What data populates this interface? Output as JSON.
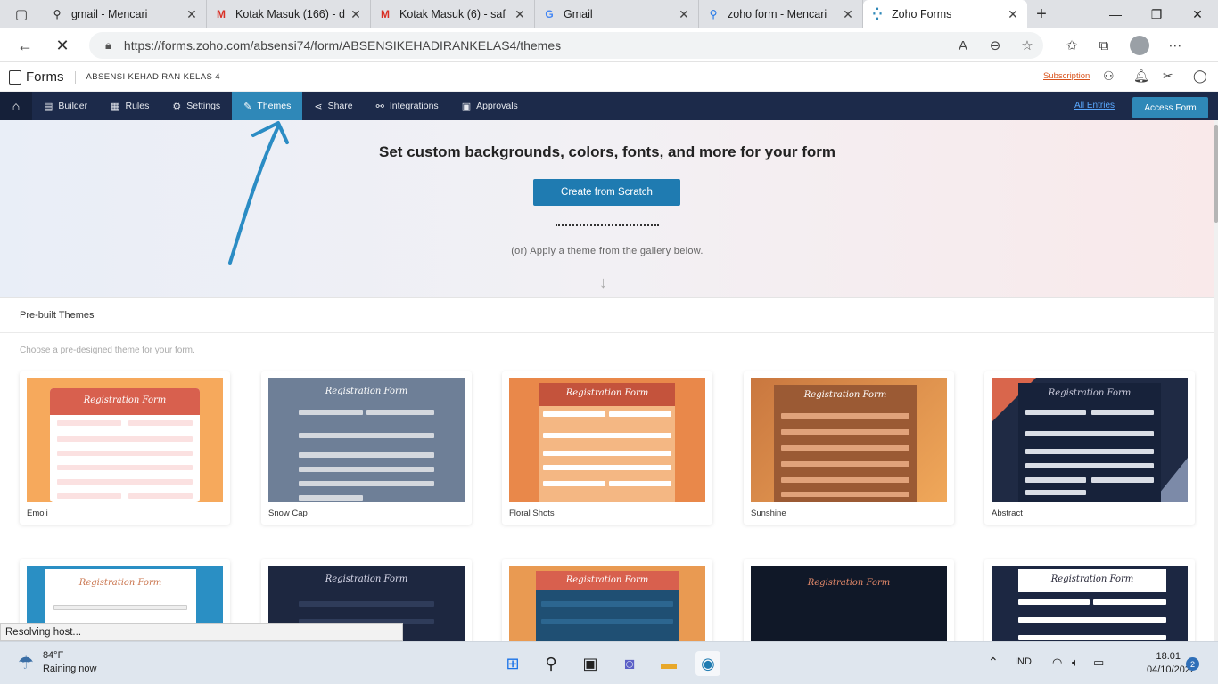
{
  "browser": {
    "tabs": [
      {
        "title": "gmail - Mencari",
        "favicon": "search-icon"
      },
      {
        "title": "Kotak Masuk (166) - d",
        "favicon": "gmail-icon"
      },
      {
        "title": "Kotak Masuk (6) - saf",
        "favicon": "gmail-icon"
      },
      {
        "title": "Gmail",
        "favicon": "google-icon"
      },
      {
        "title": "zoho form - Mencari",
        "favicon": "search-icon"
      },
      {
        "title": "Zoho Forms",
        "favicon": "zoho-icon"
      }
    ],
    "url": "https://forms.zoho.com/absensi74/form/ABSENSIKEHADIRANKELAS4/themes"
  },
  "zoho": {
    "logo": "Forms",
    "form_name": "ABSENSI KEHADIRAN KELAS 4",
    "subscription": "Subscription",
    "nav": [
      {
        "label": "Builder"
      },
      {
        "label": "Rules"
      },
      {
        "label": "Settings"
      },
      {
        "label": "Themes"
      },
      {
        "label": "Share"
      },
      {
        "label": "Integrations"
      },
      {
        "label": "Approvals"
      }
    ],
    "all_entries": "All Entries",
    "access_form": "Access Form"
  },
  "hero": {
    "heading": "Set custom backgrounds, colors, fonts, and more for your form",
    "button": "Create from Scratch",
    "or_text": "(or) Apply a theme from the gallery below."
  },
  "themes": {
    "title": "Pre-built Themes",
    "subtitle": "Choose a pre-designed theme for your form.",
    "preview_title": "Registration Form",
    "items": [
      {
        "name": "Emoji"
      },
      {
        "name": "Snow Cap"
      },
      {
        "name": "Floral Shots"
      },
      {
        "name": "Sunshine"
      },
      {
        "name": "Abstract"
      }
    ]
  },
  "status": "Resolving host...",
  "taskbar": {
    "temp": "84°F",
    "weather": "Raining now",
    "lang": "IND",
    "time": "18.01",
    "date": "04/10/2022",
    "notifications": "2"
  },
  "colors": {
    "nav_bg": "#1c2a4a",
    "accent": "#2f88b8",
    "annotation": "#2b8cc4"
  }
}
